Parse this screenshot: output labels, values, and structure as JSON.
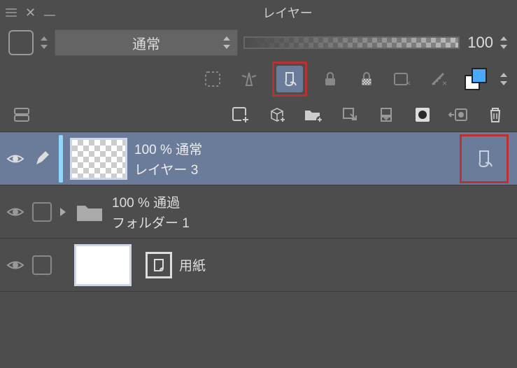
{
  "panel_title": "レイヤー",
  "blend_mode": "通常",
  "opacity_value": "100",
  "layers": [
    {
      "opacity_label": "100 %  通常",
      "name": "レイヤー 3"
    },
    {
      "opacity_label": "100 %  通過",
      "name": "フォルダー 1"
    },
    {
      "name": "用紙"
    }
  ]
}
